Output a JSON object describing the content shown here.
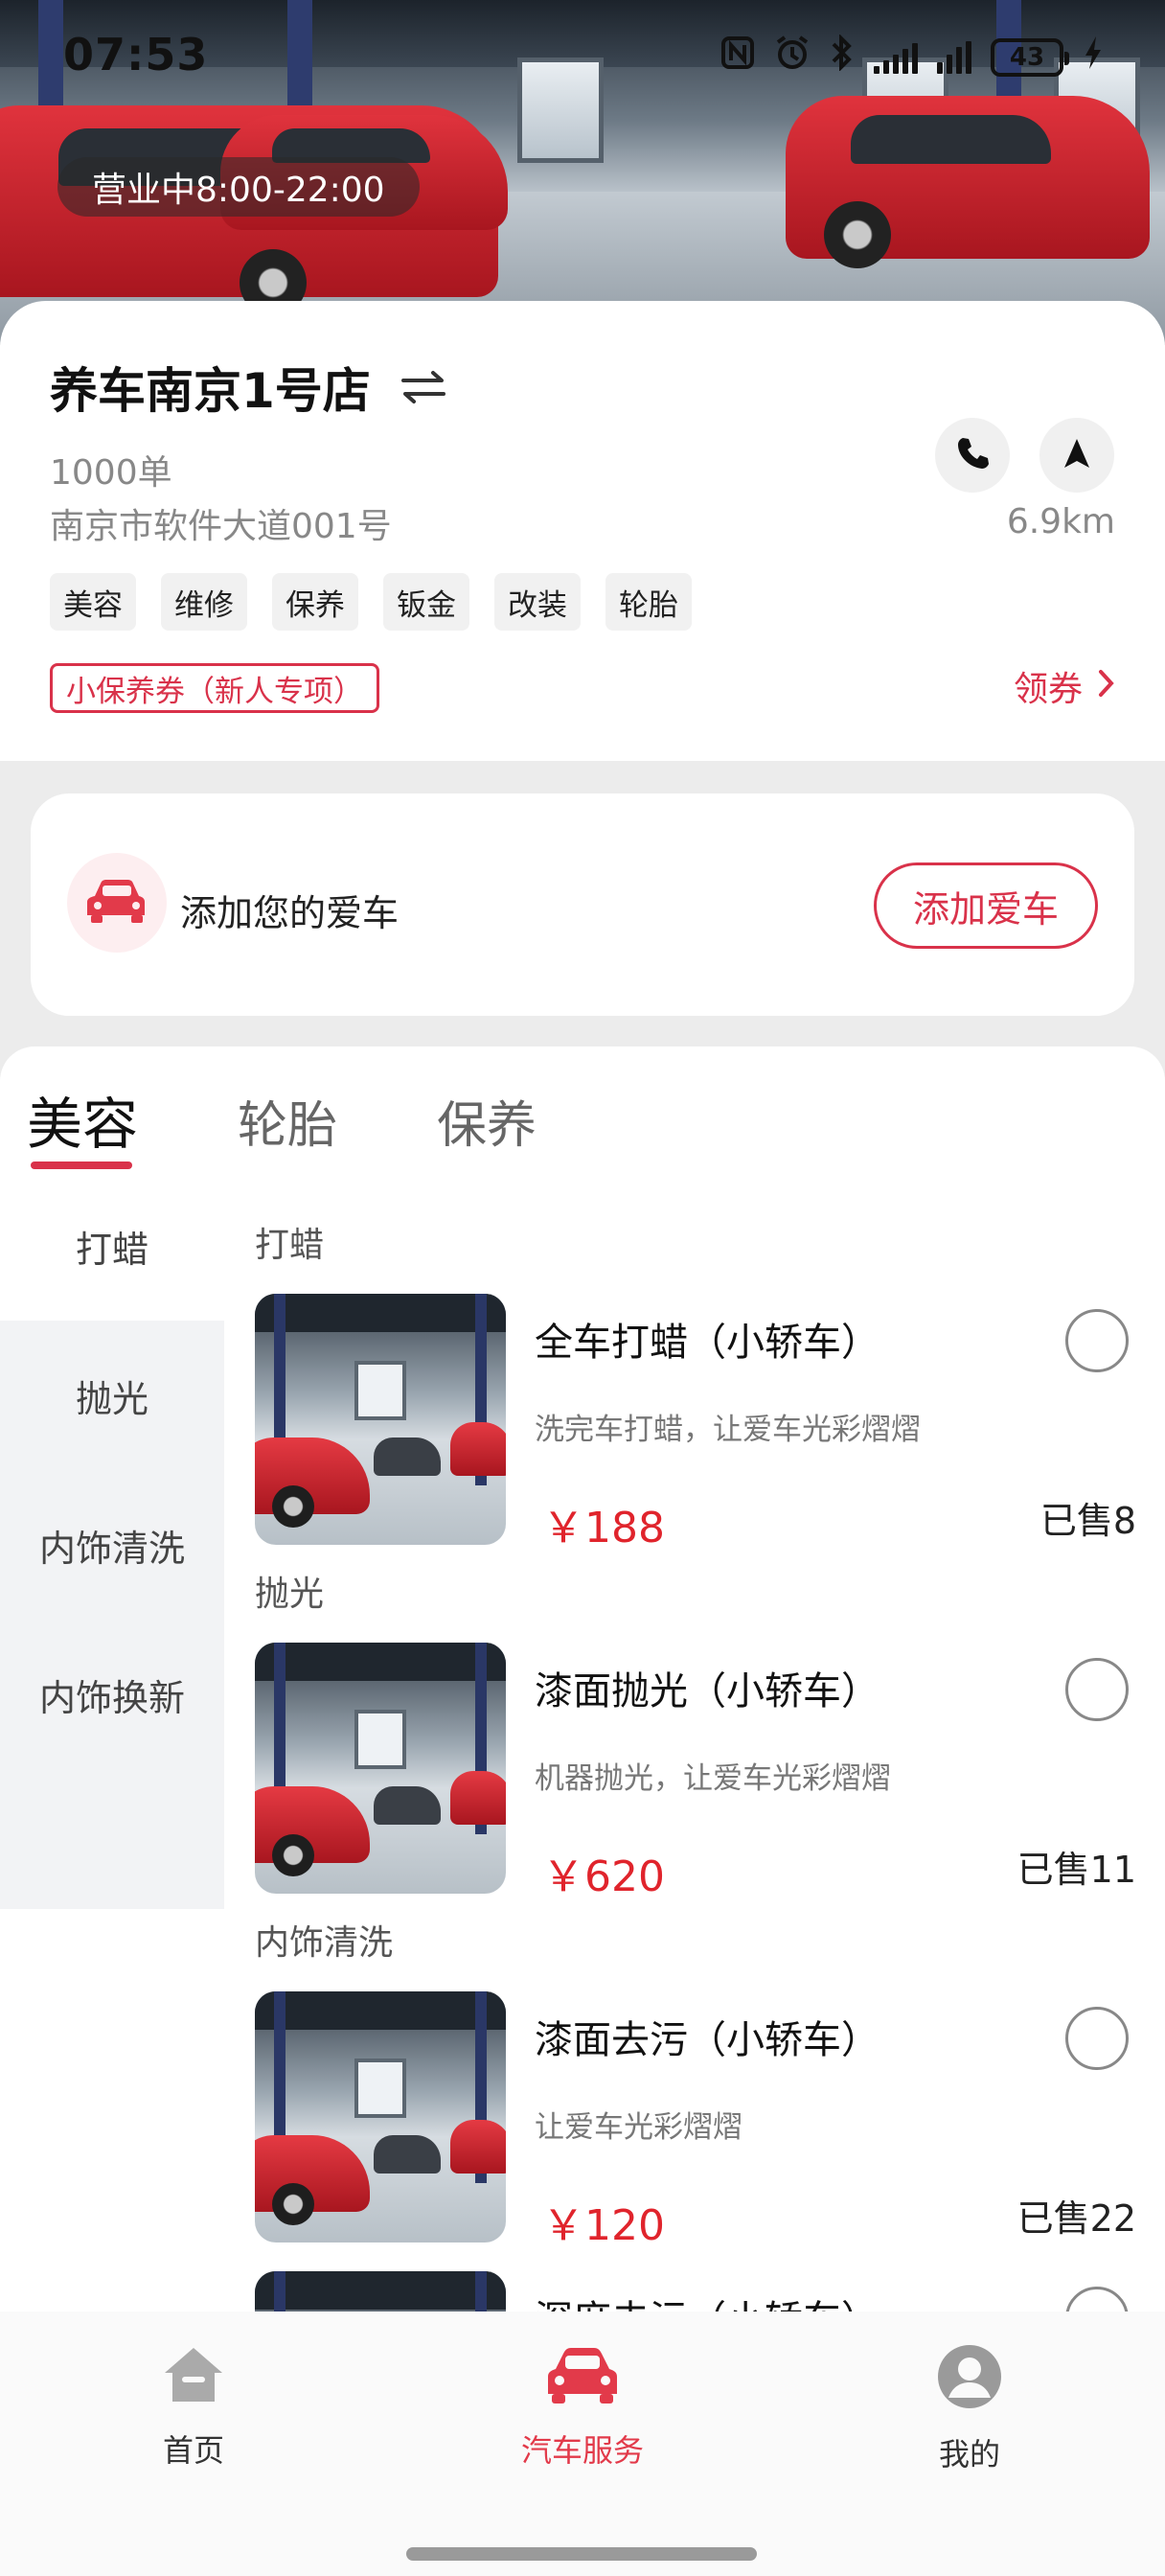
{
  "status_bar": {
    "time": "07:53",
    "battery": "43"
  },
  "store": {
    "hours": "营业中8:00-22:00",
    "name": "养车南京1号店",
    "orders": "1000单",
    "address": "南京市软件大道001号",
    "distance": "6.9km",
    "tags": [
      "美容",
      "维修",
      "保养",
      "钣金",
      "改装",
      "轮胎"
    ],
    "coupon": "小保养券（新人专项）",
    "claim_label": "领券"
  },
  "add_car": {
    "label": "添加您的爱车",
    "button": "添加爱车"
  },
  "tabs": [
    "美容",
    "轮胎",
    "保养"
  ],
  "sidebar": [
    "打蜡",
    "抛光",
    "内饰清洗",
    "内饰换新"
  ],
  "items": [
    {
      "section": "打蜡",
      "title": "全车打蜡（小轿车）",
      "desc": "洗完车打蜡，让爱车光彩熠熠",
      "price": "￥188",
      "sold": "已售8"
    },
    {
      "section": "抛光",
      "title": "漆面抛光（小轿车）",
      "desc": "机器抛光，让爱车光彩熠熠",
      "price": "￥620",
      "sold": "已售11"
    },
    {
      "section": "内饰清洗",
      "title": "漆面去污（小轿车）",
      "desc": "让爱车光彩熠熠",
      "price": "￥120",
      "sold": "已售22"
    },
    {
      "title": "深度去污（小轿车）"
    }
  ],
  "bottom_nav": [
    "首页",
    "汽车服务",
    "我的"
  ],
  "colors": {
    "accent": "#d9324a",
    "price": "#e0242c",
    "sidebar_bg": "#f2f3f5"
  }
}
